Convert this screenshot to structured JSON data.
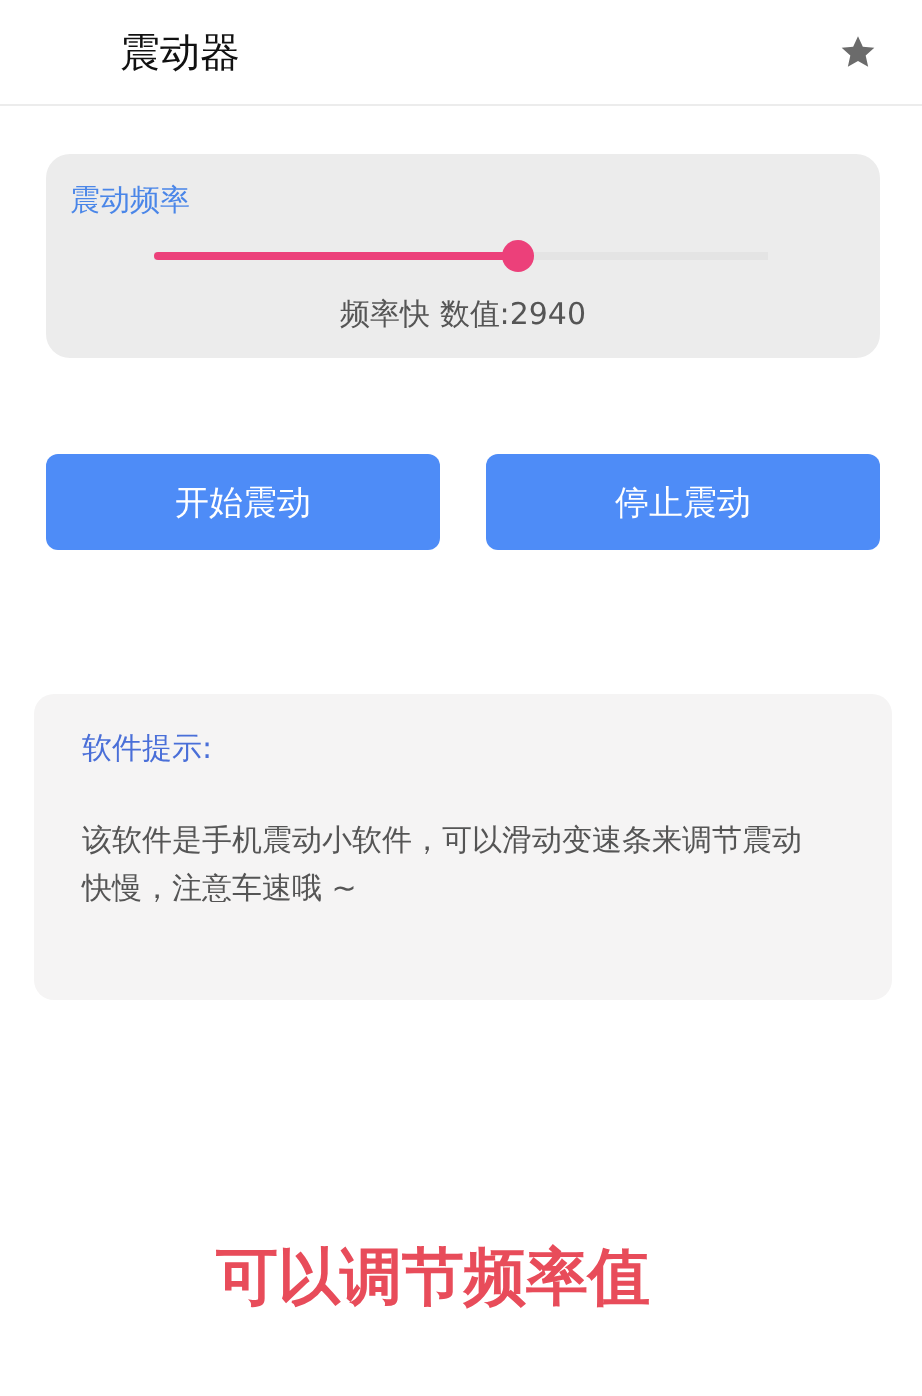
{
  "app_bar": {
    "title": "震动器"
  },
  "frequency_card": {
    "title": "震动频率",
    "slider": {
      "level": 0.594
    },
    "reading": "频率快 数值:2940"
  },
  "buttons": [
    {
      "label": "开始震动"
    },
    {
      "label": "停止震动"
    }
  ],
  "hint_card": {
    "title": "软件提示:",
    "body": "该软件是手机震动小软件，可以滑动变速条来调节震动快慢，注意车速哦 ~"
  },
  "caption": "可以调节频率值"
}
